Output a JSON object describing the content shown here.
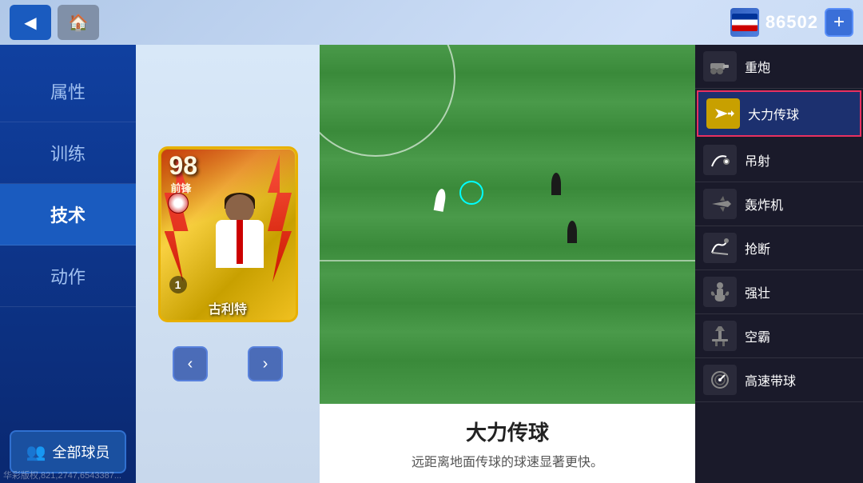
{
  "topbar": {
    "back_label": "◀",
    "home_label": "🏠",
    "currency_amount": "86502",
    "add_label": "+"
  },
  "sidebar": {
    "items": [
      {
        "label": "属性",
        "id": "attributes",
        "active": false
      },
      {
        "label": "训练",
        "id": "training",
        "active": false
      },
      {
        "label": "技术",
        "id": "skills",
        "active": true
      },
      {
        "label": "动作",
        "id": "actions",
        "active": false
      }
    ],
    "all_players_label": "全部球员",
    "watermark": "华彩版权,821,2747,6543387..."
  },
  "player_card": {
    "rating": "98",
    "position": "前锋",
    "number": "1",
    "name": "古利特"
  },
  "nav": {
    "prev": "‹",
    "next": "›"
  },
  "skill_preview": {
    "title": "大力传球",
    "description": "远距离地面传球的球速显著更快。"
  },
  "skills": [
    {
      "id": "cannon-shot",
      "name": "重炮",
      "icon": "⚡",
      "active": false
    },
    {
      "id": "power-pass",
      "name": "大力传球",
      "icon": "➡",
      "active": true
    },
    {
      "id": "chip-shot",
      "name": "吊射",
      "icon": "🎯",
      "active": false
    },
    {
      "id": "bomber",
      "name": "轰炸机",
      "icon": "✈",
      "active": false
    },
    {
      "id": "tackle",
      "name": "抢断",
      "icon": "⚡",
      "active": false
    },
    {
      "id": "strong",
      "name": "强壮",
      "icon": "💪",
      "active": false
    },
    {
      "id": "air-duel",
      "name": "空霸",
      "icon": "🗼",
      "active": false
    },
    {
      "id": "speed-dribble",
      "name": "高速带球",
      "icon": "⏱",
      "active": false
    }
  ]
}
